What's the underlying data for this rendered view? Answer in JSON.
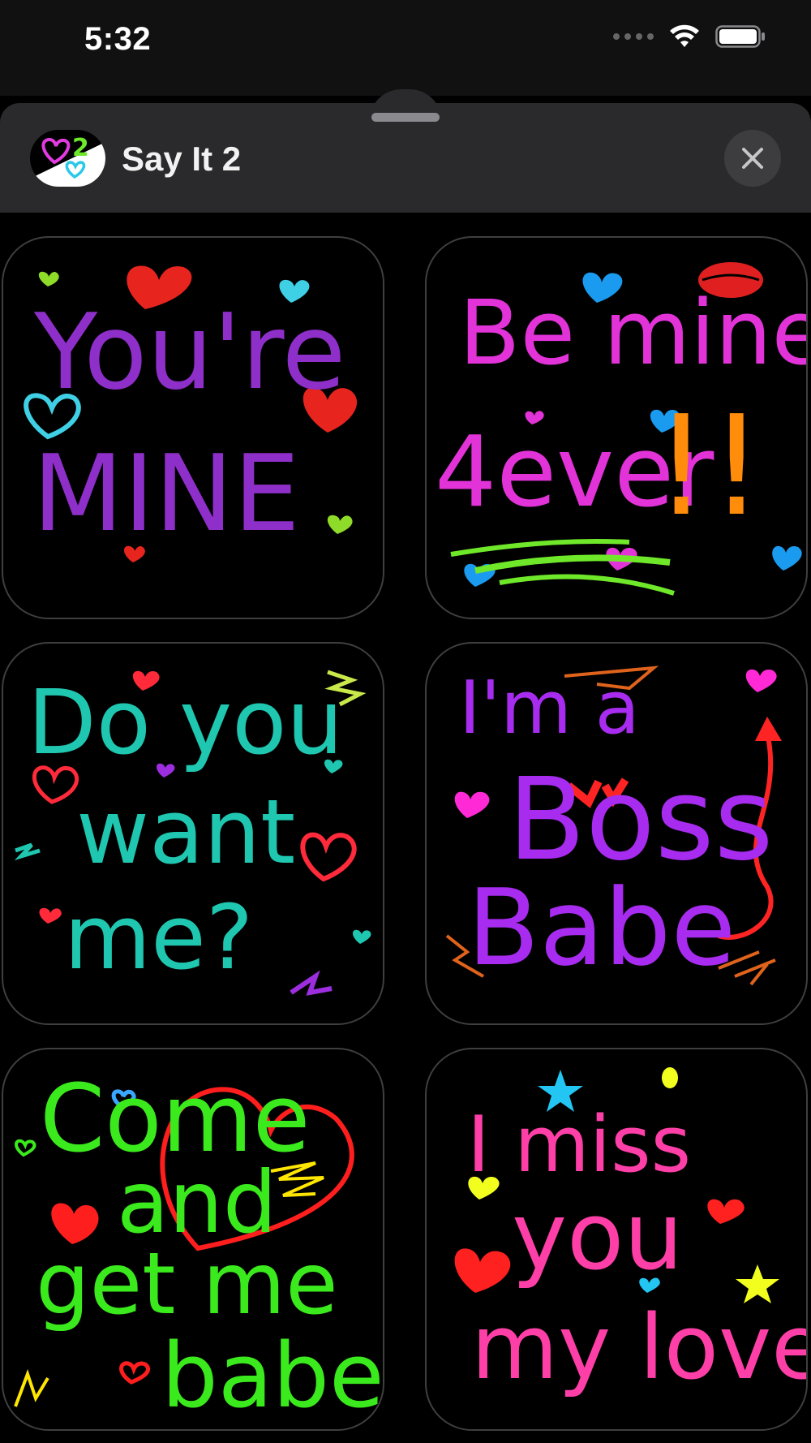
{
  "status_bar": {
    "time": "5:32"
  },
  "header": {
    "app_name": "Say It 2",
    "app_icon_text": "2"
  },
  "stickers": [
    {
      "lines": [
        "You're",
        "MINE"
      ],
      "colors": {
        "text": "#8e2fc9",
        "accent1": "#e8241f",
        "accent2": "#3fd0e6",
        "accent3": "#8edb2a"
      }
    },
    {
      "lines": [
        "Be mine",
        "4ever",
        "!!"
      ],
      "colors": {
        "text": "#e233d8",
        "accent1": "#ff8c0a",
        "accent2": "#1a9bf0",
        "accent3": "#6fe82a"
      }
    },
    {
      "lines": [
        "Do you",
        "want",
        "me?"
      ],
      "colors": {
        "text": "#1fc7b0",
        "accent1": "#ff2a3a",
        "accent2": "#9c2ee0",
        "accent3": "#c9e84a"
      }
    },
    {
      "lines": [
        "I'm a",
        "Boss",
        "Babe"
      ],
      "colors": {
        "text": "#a72cf0",
        "accent1": "#ff2424",
        "accent2": "#ff2ad6",
        "accent3": "#e0631c"
      }
    },
    {
      "lines": [
        "Come",
        "and",
        "get me",
        "babe"
      ],
      "colors": {
        "text": "#3bea1d",
        "accent1": "#ff1e1e",
        "accent2": "#3aa6ff",
        "accent3": "#ffe600"
      }
    },
    {
      "lines": [
        "I miss",
        "you",
        "my love"
      ],
      "colors": {
        "text": "#ff3fa8",
        "accent1": "#ff2020",
        "accent2": "#23c6f2",
        "accent3": "#f2ff1e"
      }
    }
  ]
}
